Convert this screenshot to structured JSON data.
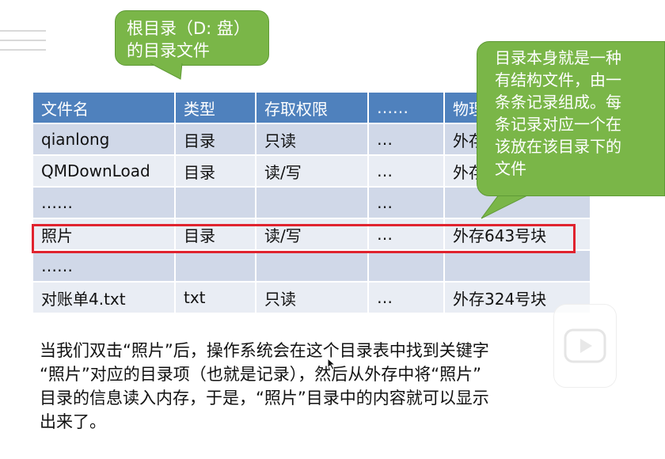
{
  "callout_root": {
    "line1": "根目录（D: 盘）",
    "line2": "的目录文件"
  },
  "callout_dir": {
    "lines": [
      "目录本身就是一种",
      "有结构文件，由一",
      "条条记录组成。每",
      "条记录对应一个在",
      "该放在该目录下的",
      "文件"
    ]
  },
  "table": {
    "headers": [
      "文件名",
      "类型",
      "存取权限",
      "……",
      "物理位置"
    ],
    "rows": [
      [
        "qianlong",
        "目录",
        "只读",
        "…",
        "外存"
      ],
      [
        "QMDownLoad",
        "目录",
        "读/写",
        "…",
        "外存"
      ],
      [
        "……",
        "",
        "",
        "…",
        ""
      ],
      [
        "照片",
        "目录",
        "读/写",
        "…",
        "外存643号块"
      ],
      [
        "……",
        "",
        "",
        "",
        ""
      ],
      [
        "对账单4.txt",
        "txt",
        "只读",
        "…",
        "外存324号块"
      ]
    ]
  },
  "bottom_text": {
    "line1": "当我们双击“照片”后，操作系统会在这个目录表中找到关键字",
    "line2": "“照片”对应的目录项（也就是记录），然后从外存中将“照片”",
    "line3": "目录的信息读入内存，于是，“照片”目录中的内容就可以显示",
    "line4": "出来了。"
  },
  "colors": {
    "callout_green": "#7ab648",
    "table_header_blue": "#4f81bd",
    "row_odd": "#d0d8e8",
    "row_even": "#e9edf4",
    "highlight_red": "#e0232e"
  }
}
